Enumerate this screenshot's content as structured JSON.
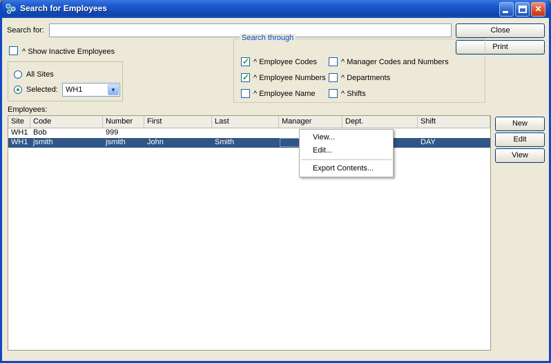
{
  "window": {
    "title": "Search for Employees"
  },
  "colors": {
    "bg": "#ECE9D8",
    "window_border": "#0F48C4",
    "titlebar_top": "#3A77E0",
    "titlebar_bottom": "#0D43AC",
    "selection": "#2F5685",
    "grouptitle": "#0046D5",
    "check": "#21A121"
  },
  "search": {
    "label": "Search for:",
    "value": ""
  },
  "buttons": {
    "close": "Close",
    "print": "Print",
    "new": "New",
    "edit": "Edit",
    "view": "View"
  },
  "show_inactive": {
    "label": "^ Show Inactive Employees",
    "checked": false
  },
  "sites": {
    "all_label": "All Sites",
    "all_checked": false,
    "selected_label": "Selected:",
    "selected_checked": true,
    "value": "WH1"
  },
  "search_through": {
    "title": "Search through",
    "options": [
      {
        "label": "^ Employee Codes",
        "checked": true
      },
      {
        "label": "^ Employee Numbers",
        "checked": true
      },
      {
        "label": "^ Employee Name",
        "checked": false
      },
      {
        "label": "^ Manager Codes and Numbers",
        "checked": false
      },
      {
        "label": "^ Departments",
        "checked": false
      },
      {
        "label": "^ Shifts",
        "checked": false
      }
    ]
  },
  "employees": {
    "label": "Employees:",
    "columns": [
      "Site",
      "Code",
      "Number",
      "First",
      "Last",
      "Manager",
      "Dept.",
      "Shift"
    ],
    "rows": [
      {
        "selected": false,
        "cells": [
          "WH1",
          "Bob",
          "999",
          "",
          "",
          "",
          "",
          ""
        ]
      },
      {
        "selected": true,
        "cells": [
          "WH1",
          "jsmith",
          "jsmith",
          "John",
          "Smith",
          "",
          "",
          "DAY"
        ]
      }
    ]
  },
  "context_menu": {
    "items": [
      "View...",
      "Edit...",
      "Export Contents..."
    ]
  }
}
